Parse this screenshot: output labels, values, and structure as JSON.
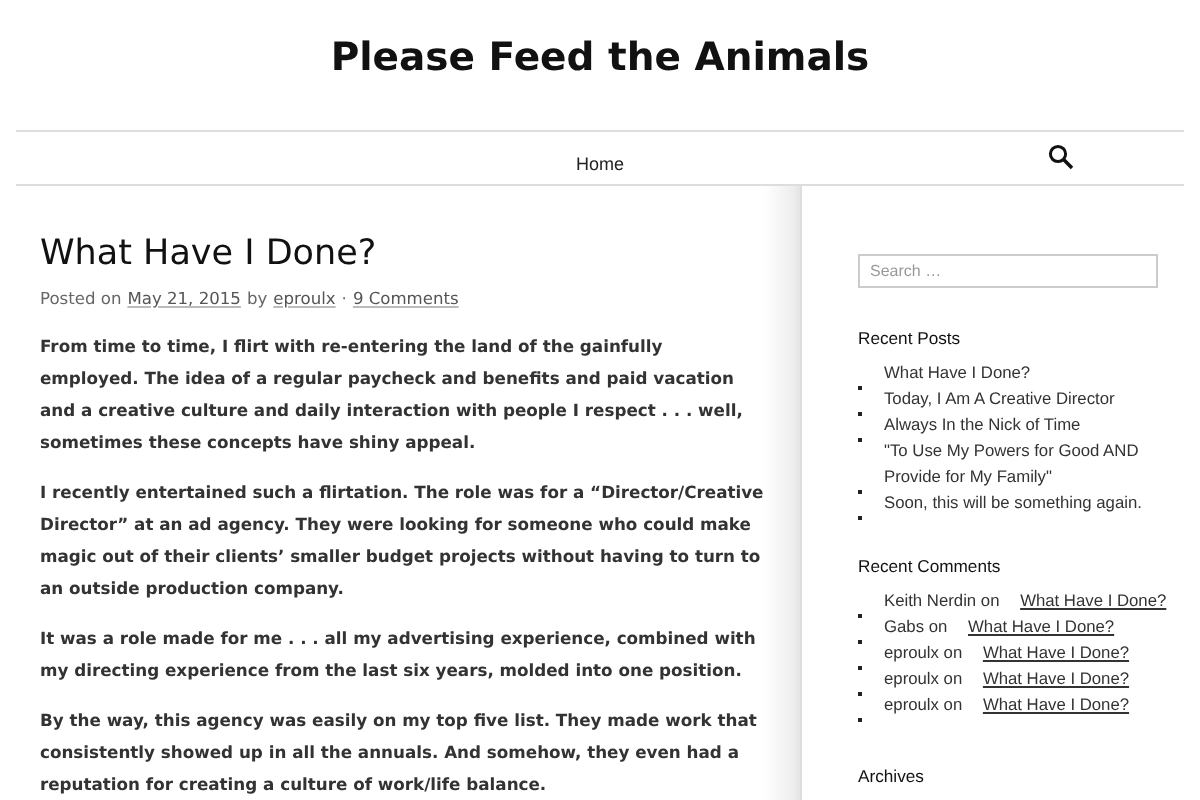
{
  "site_title": "Please Feed the Animals",
  "nav": {
    "items": [
      {
        "label": "Home"
      }
    ]
  },
  "post": {
    "title": "What Have I Done?",
    "meta": {
      "prefix": "Posted on",
      "date": "May 21, 2015",
      "by": "by",
      "author": "eproulx",
      "separator": "·",
      "comments": "9 Comments"
    },
    "paragraphs": [
      "From time to time, I flirt with re-entering the land of the gainfully employed. The idea of a regular paycheck and benefits and paid vacation and a creative culture and daily interaction with people I respect . . . well, sometimes these concepts have shiny appeal.",
      "I recently entertained such a flirtation. The role was for a “Director/Creative Director” at an ad agency. They were looking for someone who could make magic out of their clients’ smaller budget projects without having to turn to an outside production company.",
      "It was a role made for me . . . all my advertising experience, combined with my directing experience from the last six years, molded into one position.",
      "By the way, this agency was easily on my top five list. They made work that consistently showed up in all the annuals. And somehow, they even had a reputation for creating a culture of work/life balance."
    ]
  },
  "sidebar": {
    "search": {
      "placeholder": "Search …"
    },
    "recent_posts": {
      "heading": "Recent Posts",
      "items": [
        {
          "title": "What Have I Done?"
        },
        {
          "title": "Today, I Am A Creative Director"
        },
        {
          "title": "Always In the Nick of Time"
        },
        {
          "title": "\"To Use My Powers for Good AND Provide for My Family\""
        },
        {
          "title": "Soon, this will be something again."
        }
      ]
    },
    "recent_comments": {
      "heading": "Recent Comments",
      "items": [
        {
          "author": "Keith Nerdin",
          "on": "on",
          "post": "What Have I Done?"
        },
        {
          "author": "Gabs",
          "on": "on",
          "post": "What Have I Done?"
        },
        {
          "author": "eproulx",
          "on": "on",
          "post": "What Have I Done?"
        },
        {
          "author": "eproulx",
          "on": "on",
          "post": "What Have I Done?"
        },
        {
          "author": "eproulx",
          "on": "on",
          "post": "What Have I Done?"
        }
      ]
    },
    "archives": {
      "heading": "Archives"
    }
  }
}
